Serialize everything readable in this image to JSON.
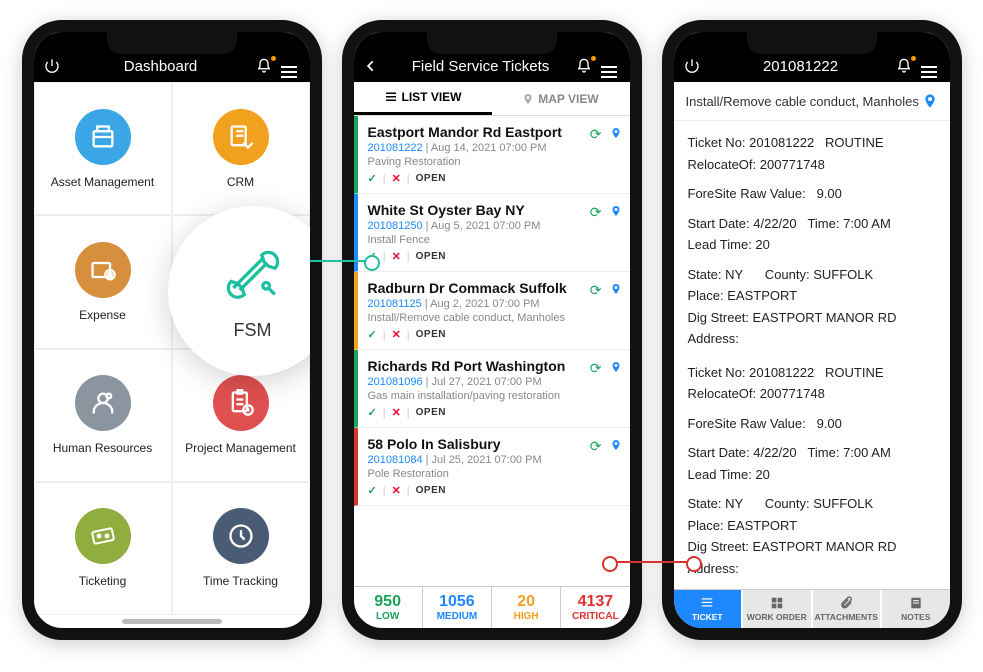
{
  "phone1": {
    "title": "Dashboard",
    "tiles": [
      {
        "label": "Asset Management",
        "color": "#3aa6e6"
      },
      {
        "label": "CRM",
        "color": "#f2a11e"
      },
      {
        "label": "Expense",
        "color": "#d88f3d"
      },
      {
        "label": "FSM",
        "color": "#1dbf9f"
      },
      {
        "label": "Human Resources",
        "color": "#8a95a0"
      },
      {
        "label": "Project Management",
        "color": "#e05050"
      },
      {
        "label": "Ticketing",
        "color": "#8fae3f"
      },
      {
        "label": "Time Tracking",
        "color": "#4a5b74"
      }
    ]
  },
  "fsm_bubble": {
    "label": "FSM"
  },
  "phone2": {
    "title": "Field Service Tickets",
    "tabs": {
      "list": "LIST VIEW",
      "map": "MAP VIEW"
    },
    "tickets": [
      {
        "title": "Eastport Mandor Rd Eastport",
        "id": "201081222",
        "date": "Aug 14, 2021 07:00 PM",
        "desc": "Paving Restoration",
        "status": "OPEN",
        "color": "#1aa35a"
      },
      {
        "title": "White St Oyster Bay NY",
        "id": "201081250",
        "date": "Aug 5, 2021 07:00 PM",
        "desc": "Install Fence",
        "status": "OPEN",
        "color": "#1e88ff"
      },
      {
        "title": "Radburn Dr Commack Suffolk",
        "id": "201081125",
        "date": "Aug 2, 2021 07:00 PM",
        "desc": "Install/Remove cable conduct, Manholes",
        "status": "OPEN",
        "color": "#f2a11e"
      },
      {
        "title": "Richards Rd Port Washington",
        "id": "201081096",
        "date": "Jul 27, 2021 07:00 PM",
        "desc": "Gas main installation/paving restoration",
        "status": "OPEN",
        "color": "#1aa35a"
      },
      {
        "title": "58 Polo In Salisbury",
        "id": "201081084",
        "date": "Jul 25, 2021 07:00 PM",
        "desc": "Pole Restoration",
        "status": "OPEN",
        "color": "#e03030"
      }
    ],
    "stats": {
      "low": {
        "n": "950",
        "label": "LOW",
        "color": "#1aa35a"
      },
      "medium": {
        "n": "1056",
        "label": "MEDIUM",
        "color": "#1e88ff"
      },
      "high": {
        "n": "20",
        "label": "HIGH",
        "color": "#f2a11e"
      },
      "critical": {
        "n": "4137",
        "label": "CRITICAL",
        "color": "#e03030"
      }
    }
  },
  "phone3": {
    "title": "201081222",
    "subtitle": "Install/Remove cable conduct, Manholes",
    "block": {
      "ticket_no_label": "Ticket No:",
      "ticket_no": "201081222",
      "routine": "ROUTINE",
      "relocate_label": "RelocateOf:",
      "relocate": "200771748",
      "foresite_label": "ForeSite Raw Value:",
      "foresite": "9.00",
      "start_date_label": "Start Date:",
      "start_date": "4/22/20",
      "time_label": "Time:",
      "time": "7:00 AM",
      "lead_label": "Lead Time:",
      "lead": "20",
      "state_label": "State:",
      "state": "NY",
      "county_label": "County:",
      "county": "SUFFOLK",
      "place_label": "Place:",
      "place": "EASTPORT",
      "street_label": "Dig Street:",
      "street": "EASTPORT MANOR RD",
      "address_label": "Address:"
    },
    "tabs": {
      "ticket": "TICKET",
      "work_order": "WORK ORDER",
      "attachments": "ATTACHMENTS",
      "notes": "NOTES"
    }
  }
}
